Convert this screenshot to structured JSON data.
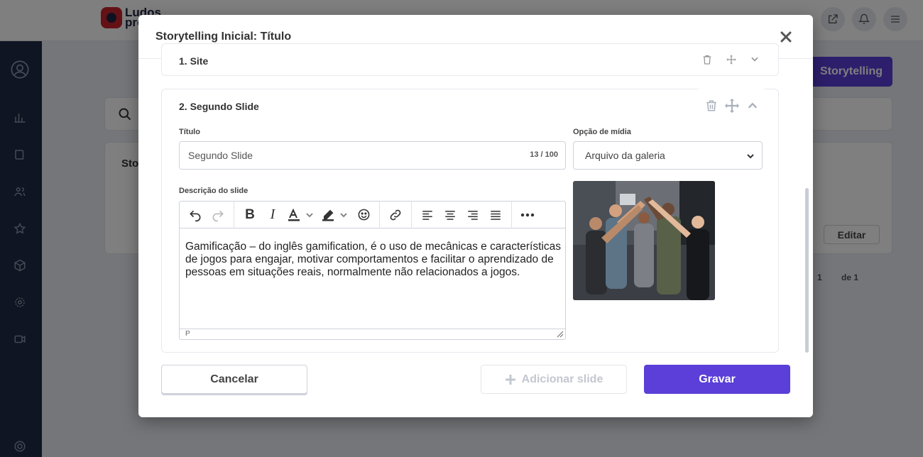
{
  "app": {
    "logo_line1": "Ludos",
    "logo_line2": "pro",
    "story_button": "Storytelling",
    "list_item_prefix": "Sto",
    "edit_button": "Editar",
    "pager_page": "1",
    "pager_of": "de 1"
  },
  "modal": {
    "title": "Storytelling Inicial: Título",
    "prev_slide_title": "1. Site",
    "slide": {
      "title": "2. Segundo Slide",
      "title_label": "Título",
      "title_value": "Segundo Slide",
      "title_counter": "13 / 100",
      "media_label": "Opção de mídia",
      "media_value": "Arquivo da galeria",
      "description_label": "Descrição do slide",
      "description_text": "Gamificação – do inglês gamification, é o uso de mecânicas e características de jogos para engajar, motivar comportamentos e facilitar o aprendizado de pessoas em situações reais, normalmente não relacionados a jogos.",
      "editor_path": "P"
    },
    "buttons": {
      "cancel": "Cancelar",
      "add_slide": "Adicionar slide",
      "save": "Gravar"
    }
  },
  "colors": {
    "primary": "#5b3fd8",
    "sidebar": "#1f2a44",
    "brand_red": "#c8232c"
  }
}
